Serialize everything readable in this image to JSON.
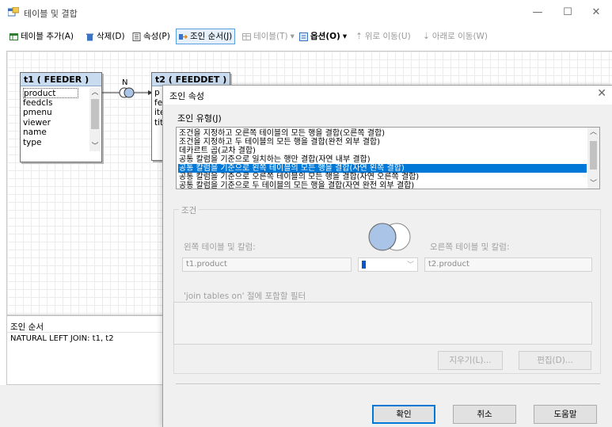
{
  "window": {
    "title": "테이블 및 결합",
    "minimize": "—",
    "maximize": "☐",
    "close": "✕"
  },
  "toolbar": {
    "add_table": "테이블 추가(A)",
    "delete": "삭제(D)",
    "properties": "속성(P)",
    "join_order": "조인 순서(J)",
    "table": "테이블(T)",
    "options": "옵션(O)",
    "move_up": "위로 이동(U)",
    "move_down": "아래로 이동(W)"
  },
  "tables": [
    {
      "name": "t1 ( FEEDER )",
      "columns": [
        "product",
        "feedcls",
        "pmenu",
        "viewer",
        "name",
        "type"
      ]
    },
    {
      "name": "t2 ( FEEDDET )",
      "columns": [
        "p",
        "fe",
        "ite",
        "tit"
      ]
    }
  ],
  "join_link": {
    "label": "N"
  },
  "join_order_pane": {
    "label": "조인 순서",
    "value": "NATURAL LEFT JOIN: t1, t2"
  },
  "dialog": {
    "title": "조인 속성",
    "join_type_label": "조인 유형(J)",
    "join_types": [
      "조건을 지정하고 오른쪽 테이블의 모든 행을 결합(오른쪽 결합)",
      "조건을 지정하고 두 테이블의 모든 행을 결합(완전 외부 결합)",
      "데카르트 곱(교차 결합)",
      "공통 칼럼을 기준으로 일치하는 행만 결합(자연 내부 결합)",
      "공통 칼럼을 기준으로 왼쪽 테이블의 모든 행을 결합(자연 왼쪽 결합)",
      "공통 칼럼을 기준으로 오른쪽 테이블의 모든 행을 결합(자연 오른쪽 결합)",
      "공통 칼럼을 기준으로 두 테이블의 모든 행을 결합(자연 완전 외부 결합)"
    ],
    "selected_index": 4,
    "condition_label": "조건",
    "left_label": "왼쪽 테이블 및 칼럼:",
    "right_label": "오른쪽 테이블 및 칼럼:",
    "left_value": "t1.product",
    "right_value": "t2.product",
    "filter_label": "'join tables on' 절에 포함할 필터",
    "clear_button": "지우기(L)...",
    "edit_button": "편집(D)...",
    "ok_button": "확인",
    "cancel_button": "취소",
    "help_button": "도움말"
  },
  "colors": {
    "selection": "#0078d7",
    "table_header": "#c9dbef",
    "venn_fill": "#a9c4e6"
  }
}
